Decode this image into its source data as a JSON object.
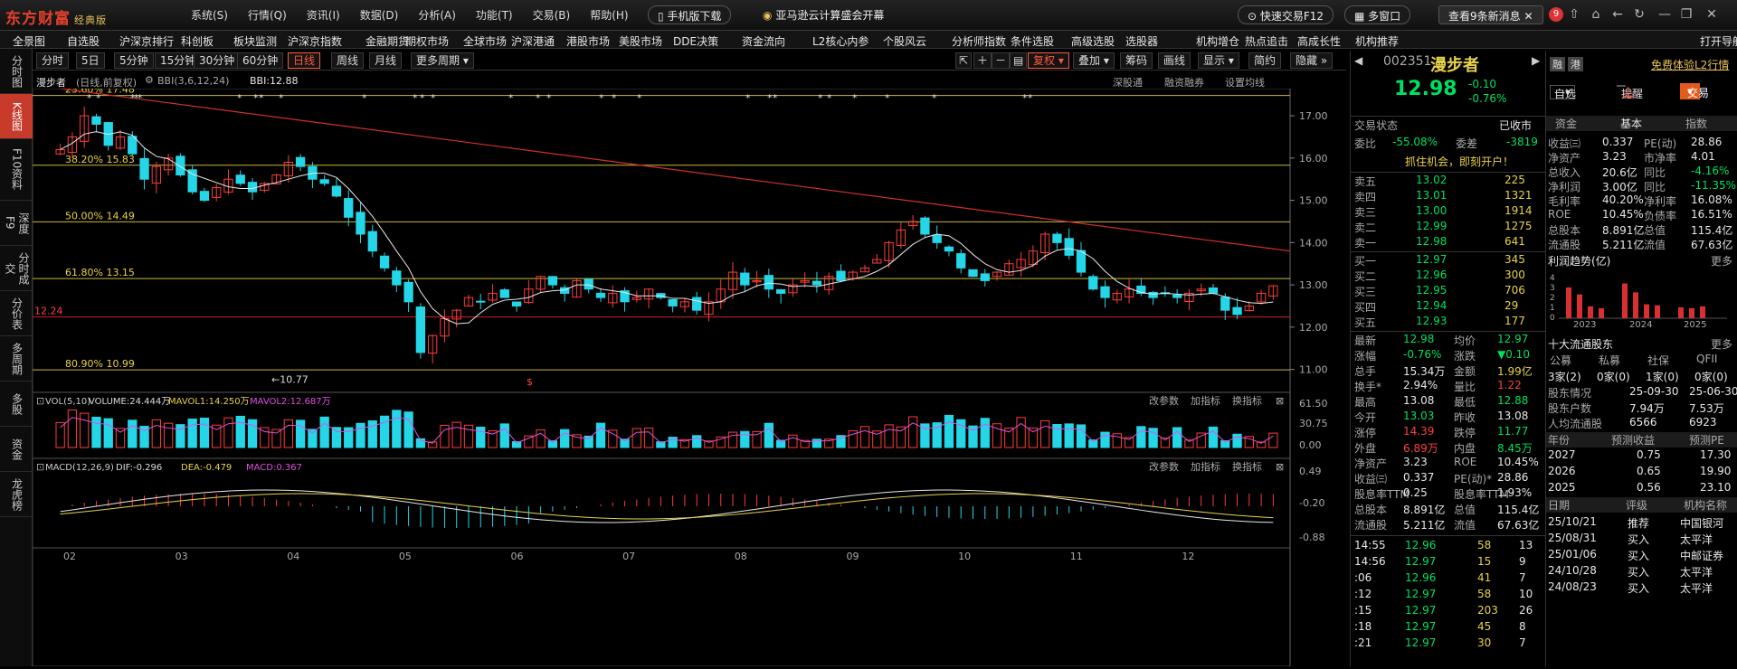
{
  "app": {
    "logo": "东方财富",
    "edition": "经典版"
  },
  "sysmenu": [
    "系统(S)",
    "行情(Q)",
    "资讯(I)",
    "数据(D)",
    "分析(A)",
    "功能(T)",
    "交易(B)",
    "帮助(H)"
  ],
  "promo": {
    "mobile": "手机版下载",
    "ad": "亚马逊云计算盛会开幕",
    "quick_trade": "快速交易F12",
    "multi_window": "多窗口",
    "news": "查看9条新消息",
    "badge": "9"
  },
  "nav": [
    "全景图",
    "自选股",
    "沪深京排行",
    "科创板",
    "板块监测",
    "沪深京指数",
    "金融期货",
    "期权市场",
    "全球市场",
    "沪深港通",
    "港股市场",
    "美股市场",
    "DDE决策",
    "资金流向",
    "L2核心内参",
    "个股风云",
    "分析师指数",
    "条件选股",
    "高级选股",
    "选股器",
    "机构增仓",
    "热点追击",
    "高成长性",
    "机构推荐",
    "打开导航"
  ],
  "left_tabs": [
    "分时图",
    "K线图",
    "F10资料",
    "深度F9",
    "分时成交",
    "分价表",
    "多周期",
    "多股",
    "资金",
    "龙虎榜"
  ],
  "toolbar": {
    "periods": [
      "分时",
      "5日",
      "5分钟",
      "15分钟",
      "30分钟",
      "60分钟",
      "日线",
      "周线",
      "月线",
      "更多周期"
    ],
    "right": [
      "复权",
      "叠加",
      "筹码",
      "画线",
      "显示",
      "简约",
      "隐藏"
    ]
  },
  "chart_header": {
    "name": "漫步者",
    "mode": "(日线,前复权)",
    "indicator": "BBI(3,6,12,24)",
    "bbi": "BBI:12.88",
    "links": [
      "深股通",
      "融资融券",
      "设置均线"
    ]
  },
  "chart_data": {
    "type": "candlestick",
    "ylim": [
      10.5,
      17.6
    ],
    "y_ticks": [
      "17.00",
      "16.00",
      "15.00",
      "14.00",
      "13.00",
      "12.00",
      "11.00"
    ],
    "x_ticks": [
      "02",
      "03",
      "04",
      "05",
      "06",
      "07",
      "08",
      "09",
      "10",
      "11",
      "12"
    ],
    "fib_lines": [
      {
        "label": "23.60% 17.48",
        "value": 17.48
      },
      {
        "label": "38.20% 15.83",
        "value": 15.83
      },
      {
        "label": "50.00% 14.49",
        "value": 14.49
      },
      {
        "label": "61.80% 13.15",
        "value": 13.15
      },
      {
        "label": "80.90% 10.99",
        "value": 10.99
      }
    ],
    "support_line": {
      "label": "12.24",
      "value": 12.24
    },
    "high_mark": "17.73",
    "low_mark": "10.77",
    "trendline": {
      "start": 17.73,
      "end": 13.8
    },
    "closes": [
      16.2,
      16.5,
      17.0,
      16.8,
      16.3,
      16.5,
      16.1,
      15.5,
      15.8,
      16.0,
      15.6,
      15.2,
      15.0,
      15.3,
      15.5,
      15.4,
      15.2,
      15.4,
      15.6,
      15.9,
      15.8,
      15.5,
      15.4,
      15.1,
      14.6,
      14.2,
      13.8,
      13.4,
      13.0,
      12.6,
      11.4,
      11.8,
      12.2,
      12.4,
      12.7,
      12.6,
      12.8,
      12.7,
      12.5,
      12.9,
      13.2,
      13.0,
      12.8,
      13.1,
      12.9,
      12.7,
      12.8,
      12.6,
      12.7,
      12.9,
      12.7,
      12.5,
      12.6,
      12.4,
      12.6,
      12.9,
      13.3,
      13.0,
      13.1,
      12.9,
      12.8,
      13.0,
      13.1,
      13.0,
      13.2,
      13.1,
      13.3,
      13.4,
      13.6,
      14.0,
      14.3,
      14.5,
      14.2,
      14.0,
      13.8,
      13.4,
      13.2,
      13.1,
      13.3,
      13.5,
      13.6,
      13.8,
      14.2,
      14.0,
      13.7,
      13.3,
      12.9,
      12.7,
      12.8,
      12.9,
      12.8,
      12.7,
      12.8,
      12.7,
      12.8,
      12.9,
      12.8,
      12.4,
      12.3,
      12.5,
      12.8,
      12.98
    ],
    "volume": {
      "label": "VOL(5,10)",
      "volume": "VOLUME:24.444万",
      "mavol1": "MAVOL1:14.250万",
      "mavol2": "MAVOL2:12.687万",
      "ticks": [
        "61.50",
        "30.75",
        "0.00"
      ]
    },
    "macd": {
      "label": "MACD(12,26,9)",
      "dif": "DIF:-0.296",
      "dea": "DEA:-0.479",
      "macd": "MACD:0.367",
      "ticks": [
        "0.49",
        "-0.20",
        "-0.88"
      ]
    },
    "sub_links": [
      "改参数",
      "加指标",
      "换指标"
    ]
  },
  "quote": {
    "code": "002351",
    "name": "漫步者",
    "price": "12.98",
    "change": "-0.10",
    "pct": "-0.76%",
    "status_label": "交易状态",
    "status": "已收市",
    "weibi_label": "委比",
    "weibi": "-55.08%",
    "weicha_label": "委差",
    "weicha": "-3819",
    "promo": "抓住机会，即刻开户！",
    "asks": [
      [
        "卖五",
        "13.02",
        "225"
      ],
      [
        "卖四",
        "13.01",
        "1321"
      ],
      [
        "卖三",
        "13.00",
        "1914"
      ],
      [
        "卖二",
        "12.99",
        "1275"
      ],
      [
        "卖一",
        "12.98",
        "641"
      ]
    ],
    "bids": [
      [
        "买一",
        "12.97",
        "345"
      ],
      [
        "买二",
        "12.96",
        "300"
      ],
      [
        "买三",
        "12.95",
        "706"
      ],
      [
        "买四",
        "12.94",
        "29"
      ],
      [
        "买五",
        "12.93",
        "177"
      ]
    ],
    "stats": [
      [
        "最新",
        "12.98",
        "均价",
        "12.97"
      ],
      [
        "涨幅",
        "-0.76%",
        "涨跌",
        "▼0.10"
      ],
      [
        "总手",
        "15.34万",
        "金额",
        "1.99亿"
      ],
      [
        "换手*",
        "2.94%",
        "量比",
        "1.22"
      ],
      [
        "最高",
        "13.08",
        "最低",
        "12.88"
      ],
      [
        "今开",
        "13.03",
        "昨收",
        "13.08"
      ],
      [
        "涨停",
        "14.39",
        "跌停",
        "11.77"
      ],
      [
        "外盘",
        "6.89万",
        "内盘",
        "8.45万"
      ],
      [
        "净资产",
        "3.23",
        "ROE",
        "10.45%"
      ],
      [
        "收益㈢",
        "0.337",
        "PE(动)*",
        "28.86"
      ],
      [
        "股息率TTM",
        "0.25",
        "股息率TTM",
        "1.93%"
      ],
      [
        "总股本",
        "8.891亿",
        "总值",
        "115.4亿"
      ],
      [
        "流通股",
        "5.211亿",
        "流值",
        "67.63亿"
      ]
    ],
    "ticks": [
      [
        "14:55",
        "12.96",
        "58",
        "13"
      ],
      [
        "14:56",
        "12.97",
        "15",
        "9"
      ],
      [
        ":06",
        "12.96",
        "41",
        "7"
      ],
      [
        ":12",
        "12.97",
        "58",
        "10"
      ],
      [
        ":15",
        "12.97",
        "203",
        "26"
      ],
      [
        ":18",
        "12.97",
        "45",
        "8"
      ],
      [
        ":21",
        "12.97",
        "30",
        "7"
      ]
    ],
    "btns": {
      "watch": "自选",
      "alert": "提醒",
      "trade": "交易",
      "free": "免费体验L2行情"
    }
  },
  "fund": {
    "tabs": [
      "资金",
      "基本",
      "指数"
    ],
    "rows": [
      [
        "收益㈢",
        "0.337",
        "PE(动)",
        "28.86"
      ],
      [
        "净资产",
        "3.23",
        "市净率",
        "4.01"
      ],
      [
        "总收入",
        "20.6亿",
        "同比",
        "-4.16%"
      ],
      [
        "净利润",
        "3.00亿",
        "同比",
        "-11.35%"
      ],
      [
        "毛利率",
        "40.20%",
        "净利率",
        "16.08%"
      ],
      [
        "ROE",
        "10.45%",
        "负债率",
        "16.51%"
      ],
      [
        "总股本",
        "8.891亿",
        "总值",
        "115.4亿"
      ],
      [
        "流通股",
        "5.211亿",
        "流值",
        "67.63亿"
      ]
    ],
    "profit_title": "利润趋势(亿)",
    "more": "更多",
    "profit_years": [
      "2023",
      "2024",
      "2025"
    ],
    "holders_title": "十大流通股东",
    "holder_cols": [
      "公募",
      "私募",
      "社保",
      "QFII"
    ],
    "holder_vals": [
      "3家(2)",
      "0家(0)",
      "1家(0)",
      "0家(0)"
    ],
    "holder_rows": [
      [
        "股东情况",
        "25-09-30",
        "25-06-30"
      ],
      [
        "股东户数",
        "7.94万",
        "7.53万"
      ],
      [
        "人均流通股",
        "6566",
        "6923"
      ]
    ],
    "forecast_cols": [
      "年份",
      "预测收益",
      "预测PE"
    ],
    "forecast": [
      [
        "2027",
        "0.75",
        "17.30"
      ],
      [
        "2026",
        "0.65",
        "19.90"
      ],
      [
        "2025",
        "0.56",
        "23.10"
      ]
    ],
    "rating_cols": [
      "日期",
      "评级",
      "机构名称"
    ],
    "ratings": [
      [
        "25/10/21",
        "推荐",
        "中国银河"
      ],
      [
        "25/08/31",
        "买入",
        "太平洋"
      ],
      [
        "25/01/06",
        "买入",
        "中邮证券"
      ],
      [
        "24/10/28",
        "买入",
        "太平洋"
      ],
      [
        "24/08/23",
        "买入",
        "太平洋"
      ]
    ]
  }
}
